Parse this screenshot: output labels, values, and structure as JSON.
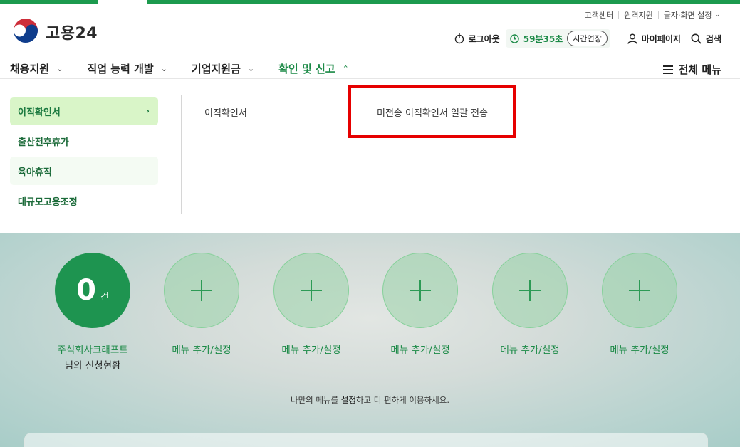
{
  "header": {
    "utility": [
      "고객센터",
      "원격지원",
      "글자·화면 설정"
    ],
    "logo_text": "고용24",
    "logout_label": "로그아웃",
    "timer": "59분35초",
    "extend_label": "시간연장",
    "mypage_label": "마이페이지",
    "search_label": "검색"
  },
  "nav": {
    "menus": [
      "채용지원",
      "직업 능력 개발",
      "기업지원금",
      "확인 및 신고"
    ],
    "active_index": 3,
    "all_menu_label": "전체 메뉴"
  },
  "dropdown": {
    "submenus": [
      "이직확인서",
      "출산전후휴가",
      "육아휴직",
      "대규모고용조정"
    ],
    "selected": "이직확인서",
    "items": [
      "이직확인서",
      "미전송 이직확인서 일괄 전송"
    ]
  },
  "dashboard": {
    "count_value": "0",
    "count_unit": "건",
    "company": "주식회사크래프트",
    "status_label": "님의 신청현황",
    "add_label": "메뉴 추가/설정",
    "hint_before": "나만의 메뉴를 ",
    "hint_link": "설정",
    "hint_after": "하고 더 편하게 이용하세요."
  },
  "colors": {
    "brand_green": "#1c8a47",
    "selected_bg": "#d9f5c8",
    "highlight": "#e60000"
  }
}
